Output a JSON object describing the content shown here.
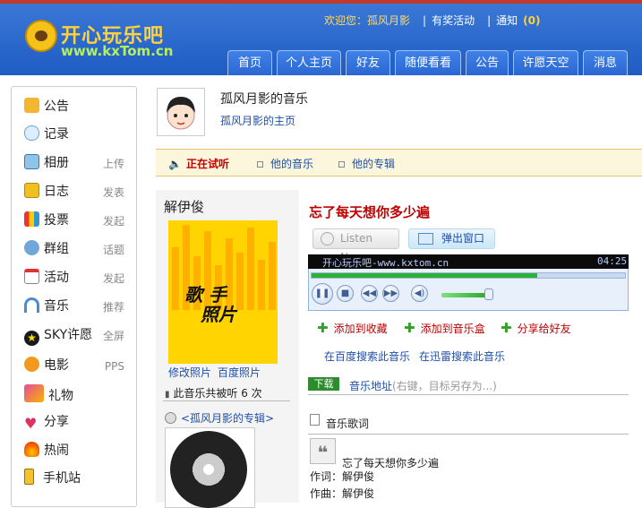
{
  "header": {
    "site_name": "开心玩乐吧",
    "site_url": "www.kxTom.cn",
    "welcome_prefix": "欢迎您：",
    "username": "孤风月影",
    "rewards": "有奖活动",
    "notify_label": "通知",
    "notify_count": "(0)"
  },
  "nav": [
    "首页",
    "个人主页",
    "好友",
    "随便看看",
    "公告",
    "许愿天空",
    "消息"
  ],
  "sidebar": {
    "items": [
      {
        "label": "公告",
        "sub": "",
        "icon": "megaphone-icon"
      },
      {
        "label": "记录",
        "sub": "",
        "icon": "chat-bubble-icon"
      },
      {
        "label": "相册",
        "sub": "上传",
        "icon": "photo-icon"
      },
      {
        "label": "日志",
        "sub": "发表",
        "icon": "notebook-icon"
      },
      {
        "label": "投票",
        "sub": "发起",
        "icon": "bar-chart-icon"
      },
      {
        "label": "群组",
        "sub": "话题",
        "icon": "group-icon"
      },
      {
        "label": "活动",
        "sub": "发起",
        "icon": "calendar-icon"
      },
      {
        "label": "音乐",
        "sub": "推荐",
        "icon": "headphones-icon"
      },
      {
        "label": "SKY许愿",
        "sub": "全屏",
        "icon": "star-icon"
      },
      {
        "label": "电影",
        "sub": "PPS",
        "icon": "film-icon"
      },
      {
        "label": "礼物",
        "sub": "",
        "icon": "gift-icon"
      },
      {
        "label": "分享",
        "sub": "",
        "icon": "heart-icon"
      },
      {
        "label": "热闹",
        "sub": "",
        "icon": "fire-icon"
      },
      {
        "label": "手机站",
        "sub": "",
        "icon": "phone-icon"
      }
    ]
  },
  "profile": {
    "title": "孤风月影的音乐",
    "home_link": "孤风月影的主页"
  },
  "subnav": {
    "playing": "正在试听",
    "his_music": "他的音乐",
    "his_albums": "他的专辑"
  },
  "album": {
    "artist": "解伊俊",
    "photo_caption_1": "歌 手",
    "photo_caption_2": "照片",
    "edit_photo": "修改照片",
    "baidu_photo": "百度照片",
    "play_count_prefix": "此音乐共被听",
    "play_count": "6",
    "play_count_suffix": "次",
    "album_link": "<孤风月影的专辑>"
  },
  "song": {
    "title": "忘了每天想你多少遍",
    "listen_now": "Listen Now",
    "popout": "弹出窗口",
    "player_title": "开心玩乐吧-www.kxtom.cn",
    "player_time": "04:25",
    "progress": 0.72,
    "add_fav": "添加到收藏",
    "add_box": "添加到音乐盒",
    "share": "分享给好友",
    "search_baidu": "在百度搜索此音乐",
    "search_xunlei": "在迅雷搜索此音乐",
    "download_badge": "下载",
    "download_label": "音乐地址",
    "download_hint": "(右键，目标另存为...)",
    "lyrics_heading": "音乐歌词",
    "lyrics_title": "忘了每天想你多少遍",
    "lyricist": "作词：解伊俊",
    "composer": "作曲：解伊俊"
  },
  "colors": {
    "header_blue": "#2b67d2",
    "accent_red": "#c00000",
    "link_blue": "#1f4fa8",
    "logo_yellow": "#ffd23a"
  }
}
